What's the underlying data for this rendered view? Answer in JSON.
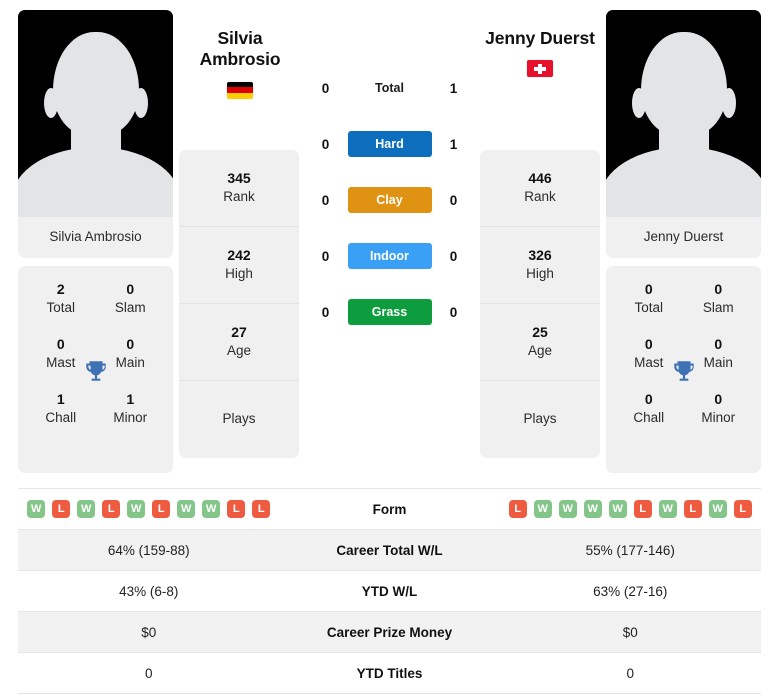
{
  "players": {
    "left": {
      "name_lines": [
        "Silvia",
        "Ambrosio"
      ],
      "full_name": "Silvia Ambrosio",
      "country_code": "DE",
      "country_name": "Germany",
      "avatar_caption": "Silvia Ambrosio",
      "titles": {
        "total_value": "2",
        "total_label": "Total",
        "slam_value": "0",
        "slam_label": "Slam",
        "mast_value": "0",
        "mast_label": "Mast",
        "main_value": "0",
        "main_label": "Main",
        "chall_value": "1",
        "chall_label": "Chall",
        "minor_value": "1",
        "minor_label": "Minor"
      },
      "rank_value": "345",
      "rank_label": "Rank",
      "high_value": "242",
      "high_label": "High",
      "age_value": "27",
      "age_label": "Age",
      "plays_value": "",
      "plays_label": "Plays",
      "form": [
        "W",
        "L",
        "W",
        "L",
        "W",
        "L",
        "W",
        "W",
        "L",
        "L"
      ],
      "career_total_wl": "64% (159-88)",
      "ytd_wl": "43% (6-8)",
      "career_prize_money": "$0",
      "ytd_titles": "0"
    },
    "right": {
      "name_lines": [
        "Jenny Duerst"
      ],
      "full_name": "Jenny Duerst",
      "country_code": "CH",
      "country_name": "Switzerland",
      "avatar_caption": "Jenny Duerst",
      "titles": {
        "total_value": "0",
        "total_label": "Total",
        "slam_value": "0",
        "slam_label": "Slam",
        "mast_value": "0",
        "mast_label": "Mast",
        "main_value": "0",
        "main_label": "Main",
        "chall_value": "0",
        "chall_label": "Chall",
        "minor_value": "0",
        "minor_label": "Minor"
      },
      "rank_value": "446",
      "rank_label": "Rank",
      "high_value": "326",
      "high_label": "High",
      "age_value": "25",
      "age_label": "Age",
      "plays_value": "",
      "plays_label": "Plays",
      "form": [
        "L",
        "W",
        "W",
        "W",
        "W",
        "L",
        "W",
        "L",
        "W",
        "L"
      ],
      "career_total_wl": "55% (177-146)",
      "ytd_wl": "63% (27-16)",
      "career_prize_money": "$0",
      "ytd_titles": "0"
    }
  },
  "head_to_head": [
    {
      "label": "Total",
      "left": "0",
      "right": "1",
      "color": "",
      "styled": false
    },
    {
      "label": "Hard",
      "left": "0",
      "right": "1",
      "color": "#0d6ebd",
      "styled": true
    },
    {
      "label": "Clay",
      "left": "0",
      "right": "0",
      "color": "#e09213",
      "styled": true
    },
    {
      "label": "Indoor",
      "left": "0",
      "right": "0",
      "color": "#3aa0f5",
      "styled": true
    },
    {
      "label": "Grass",
      "left": "0",
      "right": "0",
      "color": "#0d9d3e",
      "styled": true
    }
  ],
  "stats_rows": [
    {
      "label": "Form",
      "left": "",
      "right": "",
      "type": "form"
    },
    {
      "label": "Career Total W/L",
      "left": "64% (159-88)",
      "right": "55% (177-146)",
      "type": "text"
    },
    {
      "label": "YTD W/L",
      "left": "43% (6-8)",
      "right": "63% (27-16)",
      "type": "text"
    },
    {
      "label": "Career Prize Money",
      "left": "$0",
      "right": "$0",
      "type": "text"
    },
    {
      "label": "YTD Titles",
      "left": "0",
      "right": "0",
      "type": "text"
    }
  ],
  "colors": {
    "hard": "#0d6ebd",
    "clay": "#e09213",
    "indoor": "#3aa0f5",
    "grass": "#0d9d3e",
    "win": "#84c68a",
    "loss": "#ef5b40",
    "card_bg": "#f0f0f0",
    "row_alt_bg": "#f2f2f2"
  }
}
